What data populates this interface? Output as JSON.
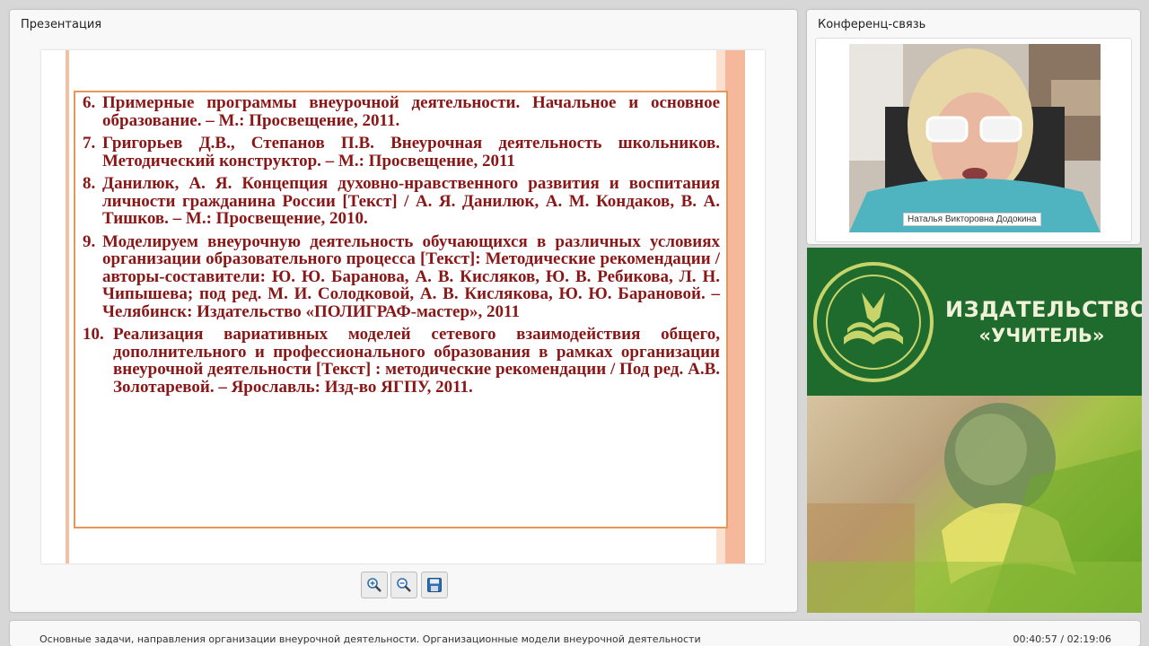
{
  "presentation": {
    "title": "Презентация",
    "slide": {
      "items": [
        {
          "num": "6.",
          "text": "Примерные программы внеурочной деятельности. Начальное и основное образование. – М.: Просвещение, 2011."
        },
        {
          "num": "7.",
          "text": "Григорьев Д.В., Степанов П.В. Внеурочная деятельность школьников. Методический конструктор. – М.: Просвещение, 2011"
        },
        {
          "num": "8.",
          "text": "Данилюк, А. Я. Концепция духовно-нравственного развития и воспитания личности гражданина России [Текст] / А. Я. Данилюк, А. М. Кондаков, В. А. Тишков. – М.: Просвещение, 2010."
        },
        {
          "num": "9.",
          "text": "Моделируем внеурочную деятельность обучающихся в различных условиях организации образовательного процесса [Текст]: Методические рекомендации / авторы-составители: Ю. Ю. Баранова, А. В. Кисляков, Ю. В. Ребикова, Л. Н. Чипышева; под ред. М. И. Солодковой, А. В. Кислякова, Ю. Ю. Барановой. – Челябинск: Издательство «ПОЛИГРАФ-мастер», 2011"
        },
        {
          "num": "10.",
          "text": "Реализация вариативных моделей сетевого взаимодействия общего, дополнительного и профессионального образования в рамках организации внеурочной деятельности [Текст] : методические рекомендации / Под ред. А.В. Золотаревой. – Ярославль: Изд-во ЯГПУ, 2011."
        }
      ]
    },
    "toolbar": {
      "zoom_in_icon": "zoom-in-icon",
      "zoom_out_icon": "zoom-out-icon",
      "save_icon": "save-icon"
    }
  },
  "conference": {
    "title": "Конференц-связь",
    "speaker_name": "Наталья Викторовна Додокина"
  },
  "banner": {
    "line1": "ИЗДАТЕЛЬСТВО",
    "line2": "«УЧИТЕЛЬ»"
  },
  "footer": {
    "title": "Основные задачи, направления организации внеурочной деятельности. Организационные модели внеурочной деятельности",
    "time": "00:40:57 / 02:19:06"
  },
  "colors": {
    "slide_text": "#8a1717",
    "slide_border": "#e8955a",
    "banner_green": "#1f6a2d"
  }
}
